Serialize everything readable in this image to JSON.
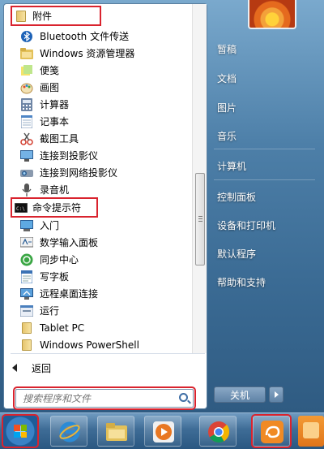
{
  "menu": {
    "programs": [
      {
        "label": "附件",
        "icon": "folder-icon",
        "highlight": true
      },
      {
        "label": "Bluetooth 文件传送",
        "icon": "bluetooth-icon"
      },
      {
        "label": "Windows 资源管理器",
        "icon": "explorer-icon"
      },
      {
        "label": "便笺",
        "icon": "sticky-notes-icon"
      },
      {
        "label": "画图",
        "icon": "paint-icon"
      },
      {
        "label": "计算器",
        "icon": "calculator-icon"
      },
      {
        "label": "记事本",
        "icon": "notepad-icon"
      },
      {
        "label": "截图工具",
        "icon": "snipping-tool-icon"
      },
      {
        "label": "连接到投影仪",
        "icon": "projector-icon"
      },
      {
        "label": "连接到网络投影仪",
        "icon": "network-projector-icon"
      },
      {
        "label": "录音机",
        "icon": "microphone-icon"
      },
      {
        "label": "命令提示符",
        "icon": "cmd-icon",
        "highlight": true
      },
      {
        "label": "入门",
        "icon": "getting-started-icon"
      },
      {
        "label": "数学输入面板",
        "icon": "math-input-icon"
      },
      {
        "label": "同步中心",
        "icon": "sync-center-icon"
      },
      {
        "label": "写字板",
        "icon": "wordpad-icon"
      },
      {
        "label": "远程桌面连接",
        "icon": "remote-desktop-icon"
      },
      {
        "label": "运行",
        "icon": "run-icon"
      },
      {
        "label": "Tablet PC",
        "icon": "folder-icon"
      },
      {
        "label": "Windows PowerShell",
        "icon": "folder-icon"
      }
    ],
    "back_label": "返回",
    "search_placeholder": "搜索程序和文件"
  },
  "right_pane": {
    "items": [
      "暂稿",
      "文档",
      "图片",
      "音乐",
      "计算机",
      "控制面板",
      "设备和打印机",
      "默认程序",
      "帮助和支持"
    ],
    "shutdown_label": "关机"
  },
  "taskbar": {
    "apps": [
      "start-orb-icon",
      "ie-icon",
      "file-explorer-icon",
      "media-player-icon",
      "chrome-icon",
      "uc-browser-icon",
      "app-icon"
    ]
  },
  "colors": {
    "highlight_outline": "#d9232e",
    "accent": "#3f6ea5"
  }
}
